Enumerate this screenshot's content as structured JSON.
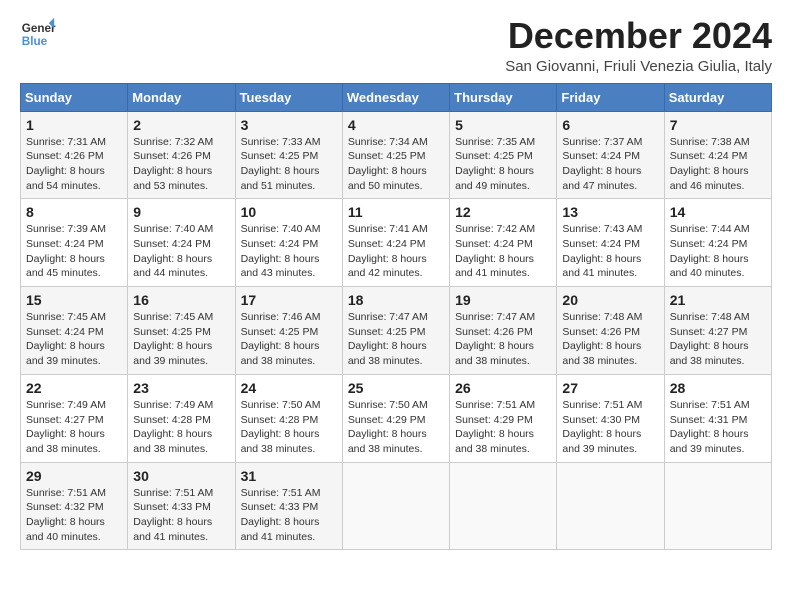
{
  "logo": {
    "line1": "General",
    "line2": "Blue"
  },
  "title": "December 2024",
  "subtitle": "San Giovanni, Friuli Venezia Giulia, Italy",
  "weekdays": [
    "Sunday",
    "Monday",
    "Tuesday",
    "Wednesday",
    "Thursday",
    "Friday",
    "Saturday"
  ],
  "weeks": [
    [
      {
        "day": 1,
        "sunrise": "7:31 AM",
        "sunset": "4:26 PM",
        "daylight": "8 hours and 54 minutes."
      },
      {
        "day": 2,
        "sunrise": "7:32 AM",
        "sunset": "4:26 PM",
        "daylight": "8 hours and 53 minutes."
      },
      {
        "day": 3,
        "sunrise": "7:33 AM",
        "sunset": "4:25 PM",
        "daylight": "8 hours and 51 minutes."
      },
      {
        "day": 4,
        "sunrise": "7:34 AM",
        "sunset": "4:25 PM",
        "daylight": "8 hours and 50 minutes."
      },
      {
        "day": 5,
        "sunrise": "7:35 AM",
        "sunset": "4:25 PM",
        "daylight": "8 hours and 49 minutes."
      },
      {
        "day": 6,
        "sunrise": "7:37 AM",
        "sunset": "4:24 PM",
        "daylight": "8 hours and 47 minutes."
      },
      {
        "day": 7,
        "sunrise": "7:38 AM",
        "sunset": "4:24 PM",
        "daylight": "8 hours and 46 minutes."
      }
    ],
    [
      {
        "day": 8,
        "sunrise": "7:39 AM",
        "sunset": "4:24 PM",
        "daylight": "8 hours and 45 minutes."
      },
      {
        "day": 9,
        "sunrise": "7:40 AM",
        "sunset": "4:24 PM",
        "daylight": "8 hours and 44 minutes."
      },
      {
        "day": 10,
        "sunrise": "7:40 AM",
        "sunset": "4:24 PM",
        "daylight": "8 hours and 43 minutes."
      },
      {
        "day": 11,
        "sunrise": "7:41 AM",
        "sunset": "4:24 PM",
        "daylight": "8 hours and 42 minutes."
      },
      {
        "day": 12,
        "sunrise": "7:42 AM",
        "sunset": "4:24 PM",
        "daylight": "8 hours and 41 minutes."
      },
      {
        "day": 13,
        "sunrise": "7:43 AM",
        "sunset": "4:24 PM",
        "daylight": "8 hours and 41 minutes."
      },
      {
        "day": 14,
        "sunrise": "7:44 AM",
        "sunset": "4:24 PM",
        "daylight": "8 hours and 40 minutes."
      }
    ],
    [
      {
        "day": 15,
        "sunrise": "7:45 AM",
        "sunset": "4:24 PM",
        "daylight": "8 hours and 39 minutes."
      },
      {
        "day": 16,
        "sunrise": "7:45 AM",
        "sunset": "4:25 PM",
        "daylight": "8 hours and 39 minutes."
      },
      {
        "day": 17,
        "sunrise": "7:46 AM",
        "sunset": "4:25 PM",
        "daylight": "8 hours and 38 minutes."
      },
      {
        "day": 18,
        "sunrise": "7:47 AM",
        "sunset": "4:25 PM",
        "daylight": "8 hours and 38 minutes."
      },
      {
        "day": 19,
        "sunrise": "7:47 AM",
        "sunset": "4:26 PM",
        "daylight": "8 hours and 38 minutes."
      },
      {
        "day": 20,
        "sunrise": "7:48 AM",
        "sunset": "4:26 PM",
        "daylight": "8 hours and 38 minutes."
      },
      {
        "day": 21,
        "sunrise": "7:48 AM",
        "sunset": "4:27 PM",
        "daylight": "8 hours and 38 minutes."
      }
    ],
    [
      {
        "day": 22,
        "sunrise": "7:49 AM",
        "sunset": "4:27 PM",
        "daylight": "8 hours and 38 minutes."
      },
      {
        "day": 23,
        "sunrise": "7:49 AM",
        "sunset": "4:28 PM",
        "daylight": "8 hours and 38 minutes."
      },
      {
        "day": 24,
        "sunrise": "7:50 AM",
        "sunset": "4:28 PM",
        "daylight": "8 hours and 38 minutes."
      },
      {
        "day": 25,
        "sunrise": "7:50 AM",
        "sunset": "4:29 PM",
        "daylight": "8 hours and 38 minutes."
      },
      {
        "day": 26,
        "sunrise": "7:51 AM",
        "sunset": "4:29 PM",
        "daylight": "8 hours and 38 minutes."
      },
      {
        "day": 27,
        "sunrise": "7:51 AM",
        "sunset": "4:30 PM",
        "daylight": "8 hours and 39 minutes."
      },
      {
        "day": 28,
        "sunrise": "7:51 AM",
        "sunset": "4:31 PM",
        "daylight": "8 hours and 39 minutes."
      }
    ],
    [
      {
        "day": 29,
        "sunrise": "7:51 AM",
        "sunset": "4:32 PM",
        "daylight": "8 hours and 40 minutes."
      },
      {
        "day": 30,
        "sunrise": "7:51 AM",
        "sunset": "4:33 PM",
        "daylight": "8 hours and 41 minutes."
      },
      {
        "day": 31,
        "sunrise": "7:51 AM",
        "sunset": "4:33 PM",
        "daylight": "8 hours and 41 minutes."
      },
      null,
      null,
      null,
      null
    ]
  ]
}
